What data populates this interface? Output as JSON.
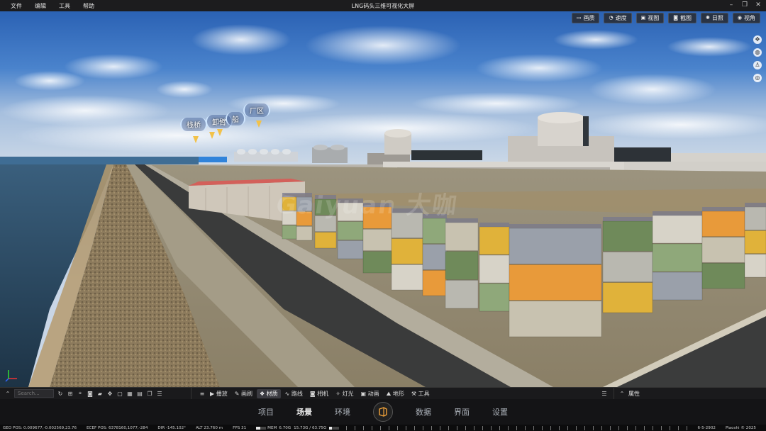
{
  "window": {
    "title": "LNG码头三维可视化大屏",
    "menu": [
      "文件",
      "编辑",
      "工具",
      "帮助"
    ]
  },
  "viewport": {
    "tools": [
      {
        "icon": "monitor-icon",
        "label": "画质"
      },
      {
        "icon": "speed-icon",
        "label": "速度"
      },
      {
        "icon": "view-icon",
        "label": "视图"
      },
      {
        "icon": "camera-icon",
        "label": "截图"
      },
      {
        "icon": "sun-icon",
        "label": "日照"
      },
      {
        "icon": "eye-icon",
        "label": "视角"
      }
    ],
    "labels": {
      "trestle": "栈桥",
      "arm": "卸臂",
      "ship": "船",
      "plant": "厂区"
    },
    "watermark": "Gaiyuan 大咖"
  },
  "toolbar": {
    "search_placeholder": "Search...",
    "tabs": [
      {
        "icon": "play-icon",
        "label": "播放"
      },
      {
        "icon": "brush-icon",
        "label": "画刷"
      },
      {
        "icon": "material-icon",
        "label": "材质",
        "active": true
      },
      {
        "icon": "route-icon",
        "label": "路线"
      },
      {
        "icon": "camera-icon",
        "label": "相机"
      },
      {
        "icon": "light-icon",
        "label": "灯光"
      },
      {
        "icon": "animation-icon",
        "label": "动画"
      },
      {
        "icon": "terrain-icon",
        "label": "地形"
      },
      {
        "icon": "tool-icon",
        "label": "工具"
      }
    ],
    "properties_label": "属性"
  },
  "nav": {
    "items": [
      "项目",
      "场景",
      "环境",
      "数据",
      "界面",
      "设置"
    ],
    "active": "场景"
  },
  "status": {
    "geo_pos": "GEO POS: 0.009677,-0.002569,23.76",
    "ecef_pos": "ECEF POS: 6378160,1077,-284",
    "dir": "DIR -145.102°",
    "alt": "ALT 23.760 m",
    "fps": "FPS 31",
    "mem_label": "MEM",
    "mem": "6.70G",
    "gpu": "15.73G / 63.75G",
    "mem_fraction": 0.45,
    "gpu_fraction": 0.25,
    "date": "6-5-2902",
    "brand": "Piaoshi © 2025"
  },
  "colors": {
    "accent": "#f2c24a",
    "toolbar_bg": "#1a1a1c"
  }
}
